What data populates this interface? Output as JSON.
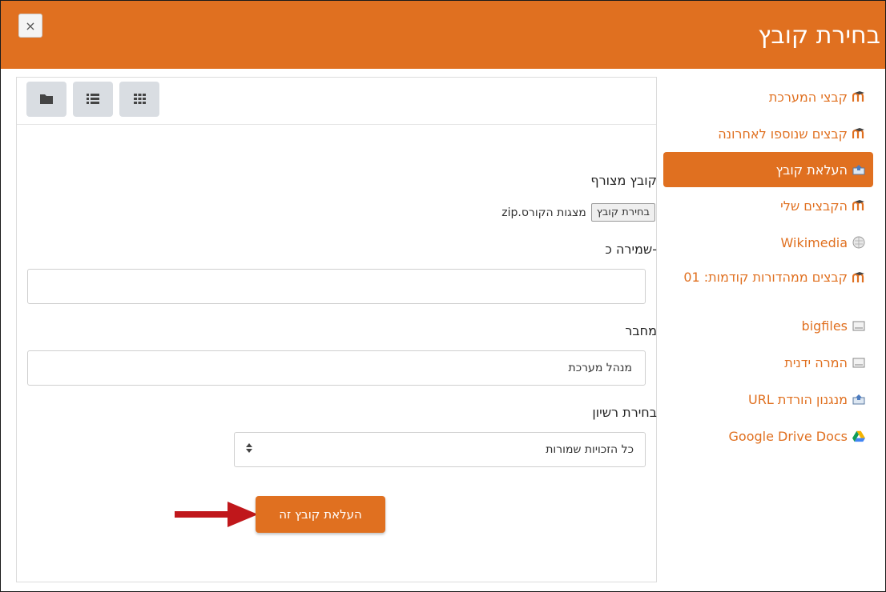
{
  "window": {
    "title": "בחירת קובץ",
    "close_label": "×"
  },
  "sidebar": {
    "items": [
      {
        "label": "קבצי המערכת",
        "icon": "moodle-icon"
      },
      {
        "label": "קבצים שנוספו לאחרונה",
        "icon": "moodle-icon"
      },
      {
        "label": "העלאת קובץ",
        "icon": "upload-icon",
        "active": true
      },
      {
        "label": "הקבצים שלי",
        "icon": "moodle-icon"
      },
      {
        "label": "Wikimedia",
        "icon": "wikimedia-icon"
      },
      {
        "label": "קבצים ממהדורות קודמות: 01",
        "icon": "moodle-icon"
      },
      {
        "label": "bigfiles",
        "icon": "drive-icon"
      },
      {
        "label": "המרה ידנית",
        "icon": "drive-icon"
      },
      {
        "label": "מנגנון הורדת URL",
        "icon": "url-download-icon"
      },
      {
        "label": "Google Drive Docs",
        "icon": "google-drive-icon"
      }
    ]
  },
  "toolbar": {
    "views": [
      "folder-view-icon",
      "list-view-icon",
      "grid-view-icon"
    ]
  },
  "form": {
    "attachment_label": "קובץ מצורף",
    "choose_file_button": "בחירת קובץ",
    "chosen_file_name": "מצגות הקורס.zip",
    "save_as_label": "שמירה כ-",
    "save_as_value": "",
    "author_label": "מחבר",
    "author_value": "מנהל מערכת",
    "license_label": "בחירת רשיון",
    "license_value": "כל הזכויות שמורות",
    "upload_button": "העלאת קובץ זה"
  },
  "colors": {
    "accent": "#e07020",
    "arrow": "#c0171b"
  }
}
